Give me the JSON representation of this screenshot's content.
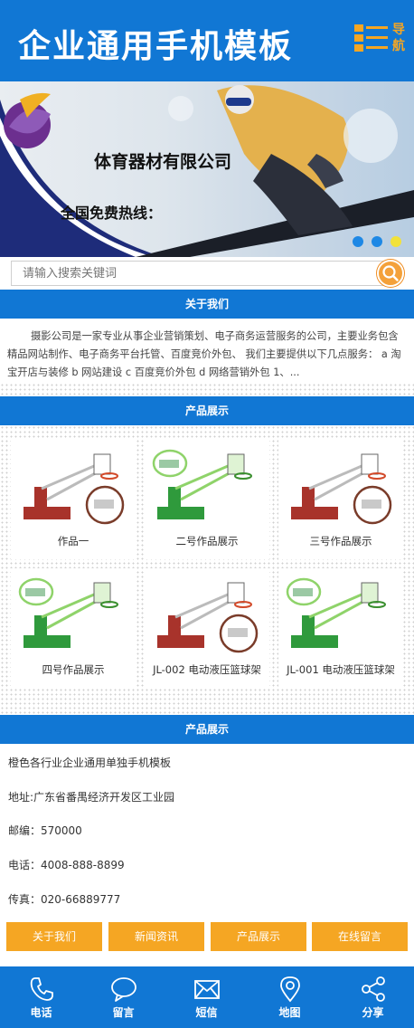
{
  "header": {
    "title": "企业通用手机模板",
    "nav_label": "导航"
  },
  "banner": {
    "company": "体育器材有限公司",
    "hotline": "全国免费热线："
  },
  "search": {
    "placeholder": "请输入搜索关键词"
  },
  "about": {
    "heading": "关于我们",
    "text": "摄影公司是一家专业从事企业营销策划、电子商务运营服务的公司，主要业务包含精品网站制作、电子商务平台托管、百度竞价外包、 我们主要提供以下几点服务： a 淘宝开店与装修 b 网站建设 c 百度竞价外包 d 网络营销外包 1、..."
  },
  "products": {
    "heading": "产品展示",
    "items": [
      {
        "caption": "作品一",
        "style": "red"
      },
      {
        "caption": "二号作品展示",
        "style": "green"
      },
      {
        "caption": "三号作品展示",
        "style": "red"
      },
      {
        "caption": "四号作品展示",
        "style": "green"
      },
      {
        "caption": "JL-002 电动液压篮球架",
        "style": "red"
      },
      {
        "caption": "JL-001 电动液压篮球架",
        "style": "green"
      }
    ]
  },
  "contact": {
    "heading": "产品展示",
    "company": "橙色各行业企业通用单独手机模板",
    "address": "地址:广东省番禺经济开发区工业园",
    "postcode": "邮编：570000",
    "phone": "电话：4008-888-8899",
    "fax": "传真：020-66889777"
  },
  "quick_links": [
    "关于我们",
    "新闻资讯",
    "产品展示",
    "在线留言"
  ],
  "footer": [
    {
      "label": "电话",
      "icon": "phone-icon"
    },
    {
      "label": "留言",
      "icon": "chat-icon"
    },
    {
      "label": "短信",
      "icon": "mail-icon"
    },
    {
      "label": "地图",
      "icon": "map-pin-icon"
    },
    {
      "label": "分享",
      "icon": "share-icon"
    }
  ],
  "colors": {
    "primary": "#1177d4",
    "accent": "#f5a623"
  }
}
